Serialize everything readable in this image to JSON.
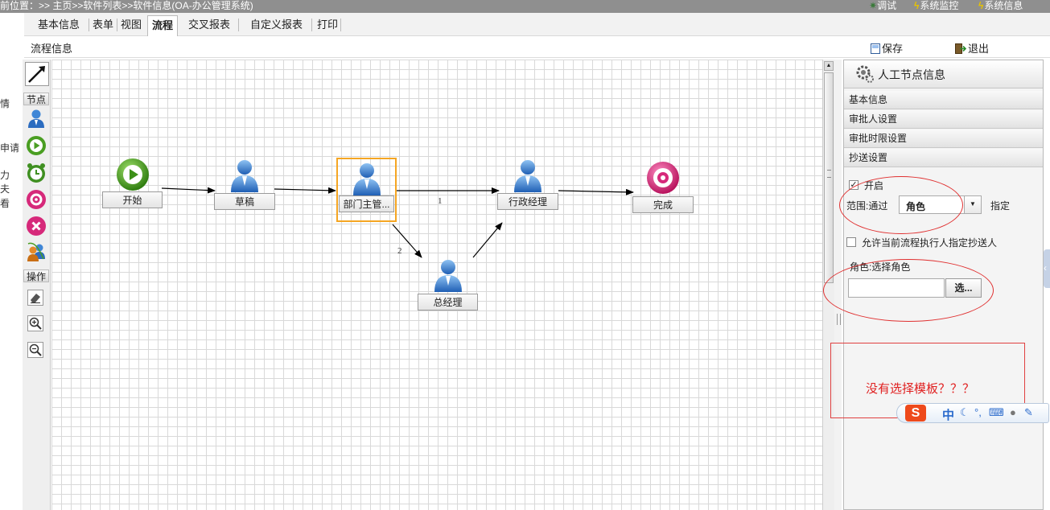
{
  "breadcrumb": "前位置：>> 主页>>软件列表>>软件信息(OA-办公管理系统)",
  "toplinks": [
    {
      "label": "调试",
      "icon": "gear-icon"
    },
    {
      "label": "系统监控",
      "icon": "lightning-icon"
    },
    {
      "label": "系统信息",
      "icon": "lightning-icon"
    }
  ],
  "leftstrip": [
    "情",
    "申请",
    "力",
    "夫",
    "看"
  ],
  "tabs": [
    {
      "label": "基本信息"
    },
    {
      "label": "表单"
    },
    {
      "label": "视图"
    },
    {
      "label": "流程",
      "active": true
    },
    {
      "label": "交叉报表"
    },
    {
      "label": "自定义报表"
    },
    {
      "label": "打印"
    }
  ],
  "toolbar": {
    "title": "流程信息",
    "save": "保存",
    "exit": "退出"
  },
  "palette": {
    "nodes_header": "节点",
    "ops_header": "操作",
    "tools": [
      "pointer-arrow-icon",
      "user-node-icon",
      "start-node-icon",
      "timer-node-icon",
      "end-node-icon",
      "cancel-node-icon",
      "group-node-icon"
    ],
    "ops": [
      "eraser-icon",
      "zoom-in-icon",
      "zoom-out-icon"
    ]
  },
  "flow": {
    "nodes": [
      {
        "id": "start",
        "label": "开始",
        "type": "start"
      },
      {
        "id": "draft",
        "label": "草稿",
        "type": "user"
      },
      {
        "id": "dept",
        "label": "部门主管...",
        "type": "user",
        "selected": true
      },
      {
        "id": "admin",
        "label": "行政经理",
        "type": "user"
      },
      {
        "id": "done",
        "label": "完成",
        "type": "end"
      },
      {
        "id": "gm",
        "label": "总经理",
        "type": "user"
      }
    ],
    "edge_labels": {
      "dept_admin": "1",
      "dept_gm": "2"
    }
  },
  "panel": {
    "title": "人工节点信息",
    "sections": [
      "基本信息",
      "审批人设置",
      "审批时限设置",
      "抄送设置"
    ],
    "enable_label": "开启",
    "enable_checked": true,
    "scope_label": "范围:通过",
    "scope_value": "角色",
    "scope_suffix": "指定",
    "allow_label": "允许当前流程执行人指定抄送人",
    "allow_checked": false,
    "role_label": "角色:选择角色",
    "role_value": "",
    "role_button": "选..."
  },
  "annotation": "没有选择模板？？？",
  "ime": {
    "logo": "S",
    "mode": "中"
  }
}
